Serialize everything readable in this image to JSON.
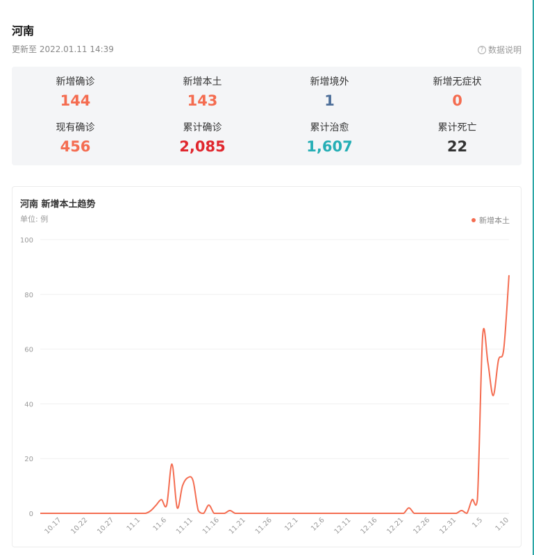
{
  "header": {
    "region": "河南",
    "updated": "更新至 2022.01.11 14:39",
    "explain": "数据说明",
    "explain_icon": "question-circle-icon"
  },
  "stats": [
    {
      "label": "新增确诊",
      "value": "144",
      "color": "#f46c50"
    },
    {
      "label": "新增本土",
      "value": "143",
      "color": "#f46c50"
    },
    {
      "label": "新增境外",
      "value": "1",
      "color": "#4e6f9a"
    },
    {
      "label": "新增无症状",
      "value": "0",
      "color": "#f46c50"
    },
    {
      "label": "现有确诊",
      "value": "456",
      "color": "#f46c50"
    },
    {
      "label": "累计确诊",
      "value": "2,085",
      "color": "#e0272e"
    },
    {
      "label": "累计治愈",
      "value": "1,607",
      "color": "#25aeb5"
    },
    {
      "label": "累计死亡",
      "value": "22",
      "color": "#333333"
    }
  ],
  "chart_data": {
    "type": "line",
    "title": "河南 新增本土趋势",
    "unit": "单位: 例",
    "ylim": [
      0,
      100
    ],
    "yticks": [
      0,
      20,
      40,
      60,
      80,
      100
    ],
    "grid": true,
    "legend_position": "top-right",
    "x_start": "10.13",
    "xticks": [
      "10.17",
      "10.22",
      "10.27",
      "11.1",
      "11.6",
      "11.11",
      "11.16",
      "11.21",
      "11.26",
      "12.1",
      "12.6",
      "12.11",
      "12.16",
      "12.21",
      "12.26",
      "12.31",
      "1.5",
      "1.10"
    ],
    "series": [
      {
        "name": "新增本土",
        "color": "#f46c50",
        "x": [
          "10.13",
          "10.14",
          "10.15",
          "10.16",
          "10.17",
          "10.18",
          "10.19",
          "10.20",
          "10.21",
          "10.22",
          "10.23",
          "10.24",
          "10.25",
          "10.26",
          "10.27",
          "10.28",
          "10.29",
          "10.30",
          "10.31",
          "11.1",
          "11.2",
          "11.3",
          "11.4",
          "11.5",
          "11.6",
          "11.7",
          "11.8",
          "11.9",
          "11.10",
          "11.11",
          "11.12",
          "11.13",
          "11.14",
          "11.15",
          "11.16",
          "11.17",
          "11.18",
          "11.19",
          "11.20",
          "11.21",
          "11.22",
          "11.23",
          "11.24",
          "11.25",
          "11.26",
          "11.27",
          "11.28",
          "11.29",
          "11.30",
          "12.1",
          "12.2",
          "12.3",
          "12.4",
          "12.5",
          "12.6",
          "12.7",
          "12.8",
          "12.9",
          "12.10",
          "12.11",
          "12.12",
          "12.13",
          "12.14",
          "12.15",
          "12.16",
          "12.17",
          "12.18",
          "12.19",
          "12.20",
          "12.21",
          "12.22",
          "12.23",
          "12.24",
          "12.25",
          "12.26",
          "12.27",
          "12.28",
          "12.29",
          "12.30",
          "12.31",
          "1.1",
          "1.2",
          "1.3",
          "1.4",
          "1.5",
          "1.6",
          "1.7",
          "1.8",
          "1.9",
          "1.10"
        ],
        "values": [
          0,
          0,
          0,
          0,
          0,
          0,
          0,
          0,
          0,
          0,
          0,
          0,
          0,
          0,
          0,
          0,
          0,
          0,
          0,
          0,
          0,
          1,
          3,
          5,
          3,
          18,
          2,
          10,
          13,
          12,
          1,
          0,
          3,
          0,
          0,
          0,
          1,
          0,
          0,
          0,
          0,
          0,
          0,
          0,
          0,
          0,
          0,
          0,
          0,
          0,
          0,
          0,
          0,
          0,
          0,
          0,
          0,
          0,
          0,
          0,
          0,
          0,
          0,
          0,
          0,
          0,
          0,
          0,
          0,
          0,
          2,
          0,
          0,
          0,
          0,
          0,
          0,
          0,
          0,
          0,
          1,
          0,
          5,
          5,
          65,
          55,
          43,
          56,
          60,
          87
        ]
      }
    ]
  }
}
